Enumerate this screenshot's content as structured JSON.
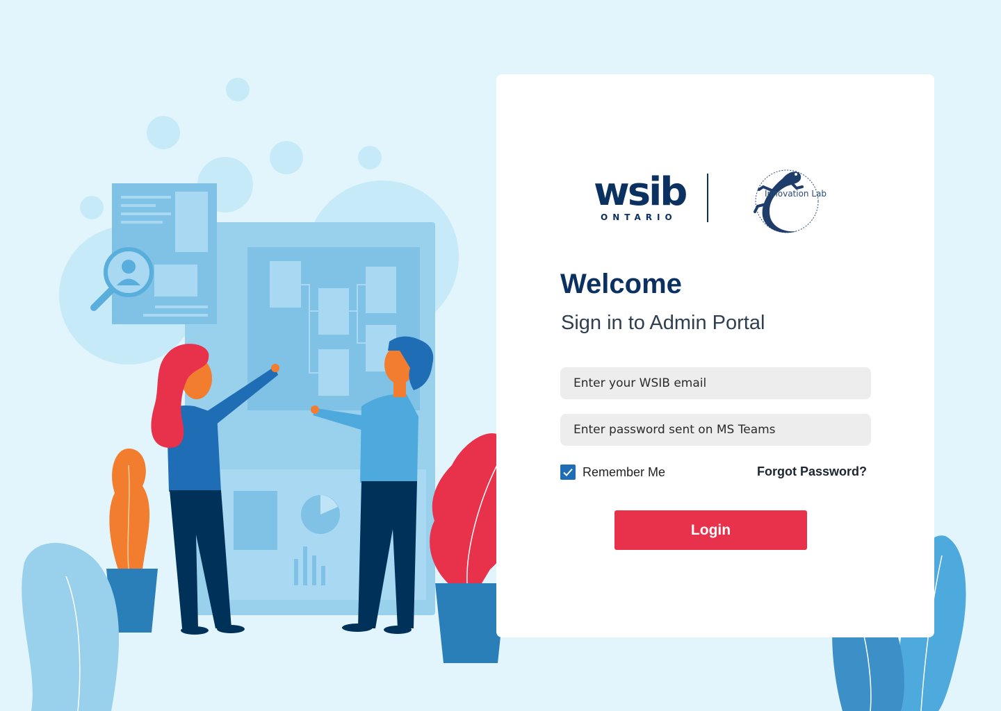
{
  "brand": {
    "wsib": "wsib",
    "wsib_sub": "ONTARIO",
    "lab": "Innovation Lab"
  },
  "login": {
    "title": "Welcome",
    "subtitle": "Sign in to Admin Portal",
    "email_placeholder": "Enter your WSIB email",
    "password_placeholder": "Enter password sent on MS Teams",
    "remember_label": "Remember Me",
    "remember_checked": true,
    "forgot_label": "Forgot Password?",
    "login_label": "Login"
  },
  "colors": {
    "background": "#e3f5fc",
    "brand_navy": "#0b3160",
    "button_red": "#e8314b",
    "checkbox_blue": "#1f6db5"
  },
  "icons": {
    "checkbox": "checkmark-icon",
    "lab_logo": "salamander-icon"
  }
}
